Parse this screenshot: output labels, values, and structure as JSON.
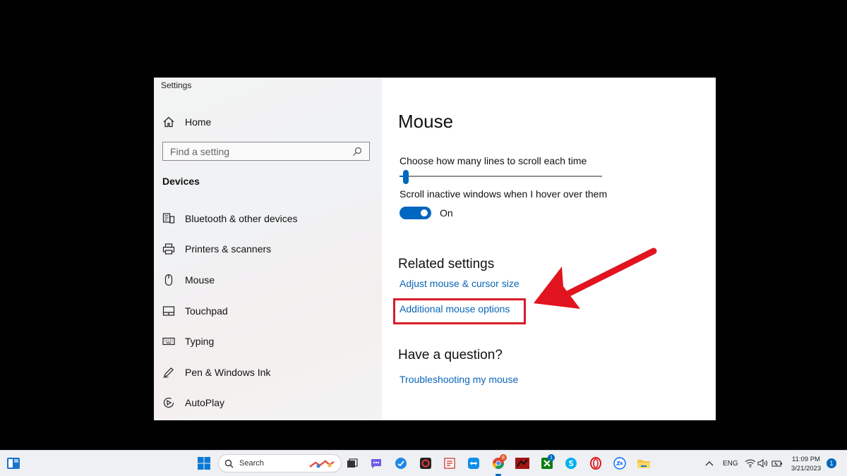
{
  "window": {
    "title": "Settings"
  },
  "sidebar": {
    "home_label": "Home",
    "search_placeholder": "Find a setting",
    "section_title": "Devices",
    "items": [
      {
        "label": "Bluetooth & other devices",
        "icon": "bluetooth-devices-icon"
      },
      {
        "label": "Printers & scanners",
        "icon": "printer-icon"
      },
      {
        "label": "Mouse",
        "icon": "mouse-icon"
      },
      {
        "label": "Touchpad",
        "icon": "touchpad-icon"
      },
      {
        "label": "Typing",
        "icon": "keyboard-icon"
      },
      {
        "label": "Pen & Windows Ink",
        "icon": "pen-icon"
      },
      {
        "label": "AutoPlay",
        "icon": "autoplay-icon"
      }
    ]
  },
  "main": {
    "title": "Mouse",
    "scroll_lines_label": "Choose how many lines to scroll each time",
    "scroll_lines_fraction": 0.03,
    "scroll_inactive_label": "Scroll inactive windows when I hover over them",
    "scroll_inactive_state": "On",
    "related_heading": "Related settings",
    "related_links": [
      "Adjust mouse & cursor size",
      "Additional mouse options"
    ],
    "question_heading": "Have a question?",
    "question_links": [
      "Troubleshooting my mouse"
    ]
  },
  "taskbar": {
    "search_label": "Search",
    "language": "ENG",
    "time": "11:09 PM",
    "date": "3/21/2023",
    "notification_count": "1",
    "chrome_badge": "8",
    "xbox_badge": "1"
  },
  "colors": {
    "accent": "#0067c0",
    "link": "#0a66b7",
    "highlight": "#d71d29"
  }
}
